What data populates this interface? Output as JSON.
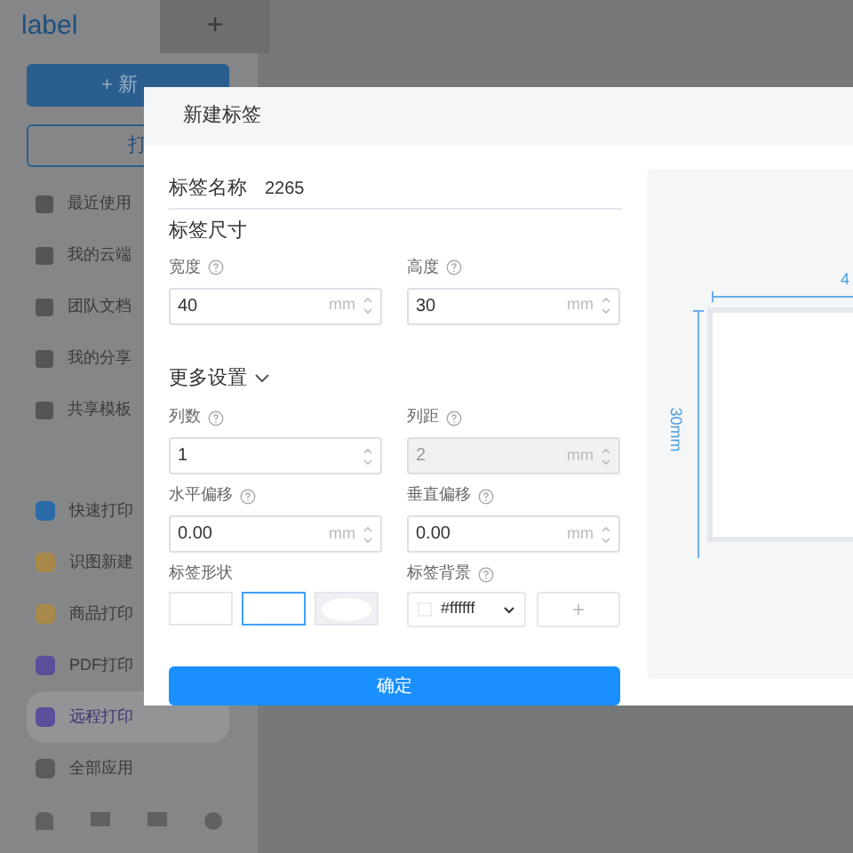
{
  "app": {
    "logo": "label",
    "new_tab": "+",
    "new_button": "+ 新",
    "open_button": "打",
    "nav_items": [
      {
        "label": "最近使用",
        "selected": false
      },
      {
        "label": "我的云端",
        "selected": false
      },
      {
        "label": "团队文档",
        "selected": false
      },
      {
        "label": "我的分享",
        "selected": false
      },
      {
        "label": "共享模板",
        "selected": false
      }
    ],
    "tools": [
      {
        "label": "快速打印",
        "color": "#2a6aa8",
        "selected": false
      },
      {
        "label": "识图新建",
        "color": "#a8894a",
        "selected": false
      },
      {
        "label": "商品打印",
        "color": "#a88a4a",
        "selected": false
      },
      {
        "label": "PDF打印",
        "color": "#5a4f9a",
        "selected": false
      },
      {
        "label": "远程打印",
        "color": "#5a4f9a",
        "selected": true
      },
      {
        "label": "全部应用",
        "color": "#5a5b5d",
        "selected": false
      }
    ]
  },
  "dialog": {
    "title": "新建标签",
    "name_label": "标签名称",
    "name_value": "2265",
    "size_title": "标签尺寸",
    "size_fields": [
      {
        "label": "宽度",
        "value": "40",
        "unit": "mm",
        "disabled": false
      },
      {
        "label": "高度",
        "value": "30",
        "unit": "mm",
        "disabled": false
      }
    ],
    "more_title": "更多设置",
    "expanded": true,
    "more_fields": [
      {
        "label": "列数",
        "value": "1",
        "disabled": false
      },
      {
        "label": "列距",
        "value": "2",
        "unit": "mm",
        "disabled": true
      },
      {
        "label": "水平偏移",
        "value": "0.00",
        "unit": "mm",
        "disabled": false
      },
      {
        "label": "垂直偏移",
        "value": "0.00",
        "unit": "mm",
        "disabled": false
      }
    ],
    "shape_label": "标签形状",
    "shapes": [
      {
        "kind": "rect",
        "selected": false
      },
      {
        "kind": "rounded",
        "selected": true
      },
      {
        "kind": "ellipse",
        "selected": false
      }
    ],
    "background_label": "标签背景",
    "background_value": "#ffffff",
    "add_button": "+",
    "confirm": "确定",
    "preview": {
      "width_text": "4",
      "height_text": "30mm"
    }
  }
}
